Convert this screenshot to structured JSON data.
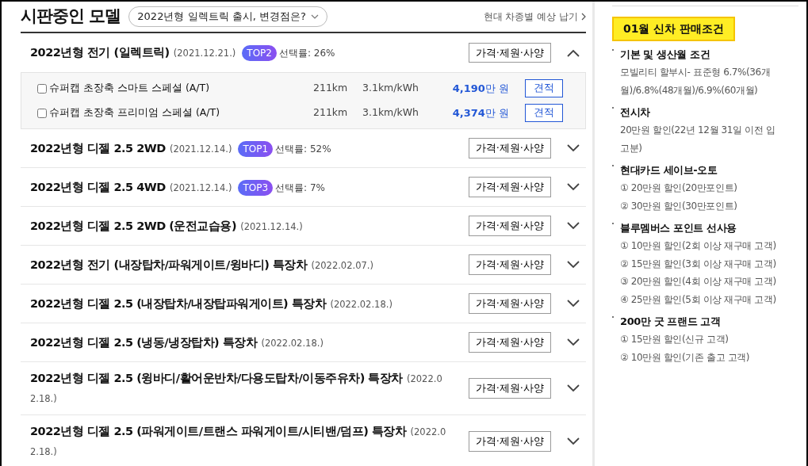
{
  "header": {
    "title": "시판중인 모델",
    "notice_pill": "2022년형 일렉트릭 출시, 변경점은?",
    "link": "현대 차종별 예상 납기"
  },
  "models": [
    {
      "name": "2022년형 전기 (일렉트릭)",
      "date": "(2021.12.21.)",
      "badge": "TOP2",
      "rate": "선택률: 26%",
      "button": "가격·제원·사양",
      "expanded": true,
      "trims": [
        {
          "name": "슈퍼캡 초장축 스마트 스페셜 (A/T)",
          "checked": false,
          "range": "211km",
          "efficiency": "3.1km/kWh",
          "price_num": "4,190",
          "price_unit": "만 원",
          "button": "견적"
        },
        {
          "name": "슈퍼캡 초장축 프리미엄 스페셜 (A/T)",
          "checked": false,
          "range": "211km",
          "efficiency": "3.1km/kWh",
          "price_num": "4,374",
          "price_unit": "만 원",
          "button": "견적"
        }
      ]
    },
    {
      "name": "2022년형 디젤 2.5 2WD",
      "date": "(2021.12.14.)",
      "badge": "TOP1",
      "rate": "선택률: 52%",
      "button": "가격·제원·사양",
      "expanded": false
    },
    {
      "name": "2022년형 디젤 2.5 4WD",
      "date": "(2021.12.14.)",
      "badge": "TOP3",
      "rate": "선택률: 7%",
      "button": "가격·제원·사양",
      "expanded": false
    },
    {
      "name": "2022년형 디젤 2.5 2WD (운전교습용)",
      "date": "(2021.12.14.)",
      "button": "가격·제원·사양",
      "expanded": false
    },
    {
      "name": "2022년형 전기 (내장탑차/파워게이트/윙바디) 특장차",
      "date": "(2022.02.07.)",
      "button": "가격·제원·사양",
      "expanded": false
    },
    {
      "name": "2022년형 디젤 2.5 (내장탑차/내장탑파워게이트) 특장차",
      "date": "(2022.02.18.)",
      "button": "가격·제원·사양",
      "expanded": false
    },
    {
      "name": "2022년형 디젤 2.5 (냉동/냉장탑차) 특장차",
      "date": "(2022.02.18.)",
      "button": "가격·제원·사양",
      "expanded": false
    },
    {
      "name": "2022년형 디젤 2.5 (윙바디/활어운반차/다용도탑차/이동주유차) 특장차",
      "date": "(2022.02.18.)",
      "button": "가격·제원·사양",
      "expanded": false
    },
    {
      "name": "2022년형 디젤 2.5 (파워게이트/트랜스 파워게이트/시티밴/덤프) 특장차",
      "date": "(2022.02.18.)",
      "button": "가격·제원·사양",
      "expanded": false
    }
  ],
  "sidebar": {
    "title": "01월 신차 판매조건",
    "sections": [
      {
        "title": "기본 및 생산월 조건",
        "lines": [
          "모빌리티 할부시- 표준형 6.7%(36개월)/6.8%(48개월)/6.9%(60개월)"
        ]
      },
      {
        "title": "전시차",
        "lines": [
          "20만원 할인(22년 12월 31일 이전 입고분)"
        ]
      },
      {
        "title": "현대카드 세이브-오토",
        "lines": [
          "① 20만원 할인(20만포인트)",
          "② 30만원 할인(30만포인트)"
        ]
      },
      {
        "title": "블루멤버스 포인트 선사용",
        "lines": [
          "① 10만원 할인(2회 이상 재구매 고객)",
          "② 15만원 할인(3회 이상 재구매 고객)",
          "③ 20만원 할인(4회 이상 재구매 고객)",
          "④ 25만원 할인(5회 이상 재구매 고객)"
        ]
      },
      {
        "title": "200만 굿 프랜드 고객",
        "lines": [
          "① 15만원 할인(신규 고객)",
          "② 10만원 할인(기존 출고 고객)"
        ]
      }
    ]
  }
}
